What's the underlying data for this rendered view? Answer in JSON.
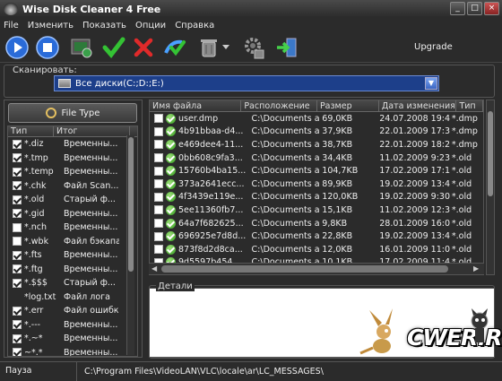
{
  "window": {
    "title": "Wise Disk Cleaner 4 Free",
    "controls": [
      "_",
      "□",
      "×"
    ]
  },
  "menu": [
    "File",
    "Изменить",
    "Показать",
    "Опции",
    "Справка"
  ],
  "toolbar": {
    "upgrade_label": "Upgrade",
    "buttons": [
      "play-icon",
      "stop-icon",
      "scan-all-icon",
      "check-all-icon",
      "uncheck-all-icon",
      "restore-icon",
      "recycle-bin-icon",
      "settings-icon",
      "exit-icon"
    ]
  },
  "scan": {
    "label": "Сканировать:",
    "selected": "Все диски(C:;D:;E:)"
  },
  "left": {
    "filetype_button": "File Type",
    "headers": [
      "Тип",
      "Итог"
    ],
    "rows": [
      {
        "checked": true,
        "type": "*.diz",
        "desc": "Временны..."
      },
      {
        "checked": true,
        "type": "*.tmp",
        "desc": "Временны..."
      },
      {
        "checked": true,
        "type": "*.temp",
        "desc": "Временны..."
      },
      {
        "checked": true,
        "type": "*.chk",
        "desc": "Файл Scan..."
      },
      {
        "checked": true,
        "type": "*.old",
        "desc": "Старый ф..."
      },
      {
        "checked": true,
        "type": "*.gid",
        "desc": "Временны..."
      },
      {
        "checked": false,
        "type": "*.nch",
        "desc": "Временны..."
      },
      {
        "checked": false,
        "type": "*.wbk",
        "desc": "Файл бэкапа"
      },
      {
        "checked": true,
        "type": "*.fts",
        "desc": "Временны..."
      },
      {
        "checked": true,
        "type": "*.ftg",
        "desc": "Временны..."
      },
      {
        "checked": true,
        "type": "*.$$$",
        "desc": "Старый ф..."
      },
      {
        "checked": null,
        "type": "*log.txt",
        "desc": "Файл лога"
      },
      {
        "checked": true,
        "type": "*.err",
        "desc": "Файл ошибки"
      },
      {
        "checked": true,
        "type": "*.---",
        "desc": "Временны..."
      },
      {
        "checked": true,
        "type": "*.~*",
        "desc": "Временны..."
      },
      {
        "checked": true,
        "type": "~*.*",
        "desc": "Временны..."
      },
      {
        "checked": true,
        "type": "*.??$",
        "desc": ""
      }
    ]
  },
  "results": {
    "headers": [
      "Имя файла",
      "Расположение",
      "Размер",
      "Дата изменения",
      "Тип"
    ],
    "rows": [
      {
        "name": "user.dmp",
        "loc": "C:\\Documents a...",
        "size": "69,0KB",
        "date": "24.07.2008 19:4...",
        "type": "*.dmp"
      },
      {
        "name": "4b91bbaa-d4...",
        "loc": "C:\\Documents a...",
        "size": "37,9KB",
        "date": "22.01.2009 17:3...",
        "type": "*.dmp"
      },
      {
        "name": "e469dee4-11...",
        "loc": "C:\\Documents a...",
        "size": "38,7KB",
        "date": "22.01.2009 18:2...",
        "type": "*.dmp"
      },
      {
        "name": "0bb608c9fa3...",
        "loc": "C:\\Documents a...",
        "size": "34,4KB",
        "date": "11.02.2009 9:23...",
        "type": "*.old"
      },
      {
        "name": "15760b4ba15...",
        "loc": "C:\\Documents a...",
        "size": "104,7KB",
        "date": "17.02.2009 17:1...",
        "type": "*.old"
      },
      {
        "name": "373a2641ecc...",
        "loc": "C:\\Documents a...",
        "size": "89,9KB",
        "date": "19.02.2009 13:4...",
        "type": "*.old"
      },
      {
        "name": "4f3439e119e...",
        "loc": "C:\\Documents a...",
        "size": "120,0KB",
        "date": "19.02.2009 9:30...",
        "type": "*.old"
      },
      {
        "name": "5ee11360fb7...",
        "loc": "C:\\Documents a...",
        "size": "15,1KB",
        "date": "11.02.2009 12:3...",
        "type": "*.old"
      },
      {
        "name": "64a7f682625...",
        "loc": "C:\\Documents a...",
        "size": "9,8KB",
        "date": "28.01.2009 16:0...",
        "type": "*.old"
      },
      {
        "name": "696925e7d8d...",
        "loc": "C:\\Documents a...",
        "size": "22,8KB",
        "date": "19.02.2009 13:4...",
        "type": "*.old"
      },
      {
        "name": "873f8d2d8ca...",
        "loc": "C:\\Documents a...",
        "size": "12,0KB",
        "date": "16.01.2009 11:0...",
        "type": "*.old"
      },
      {
        "name": "9d5597b454...",
        "loc": "C:\\Documents a...",
        "size": "10,1KB",
        "date": "17.02.2009 11:4...",
        "type": "*.old"
      }
    ]
  },
  "details": {
    "label": "Детали"
  },
  "status": {
    "state": "Пауза",
    "path": "C:\\Program Files\\VideoLAN\\VLC\\locale\\ar\\LC_MESSAGES\\"
  },
  "watermark": "CWER.RU"
}
